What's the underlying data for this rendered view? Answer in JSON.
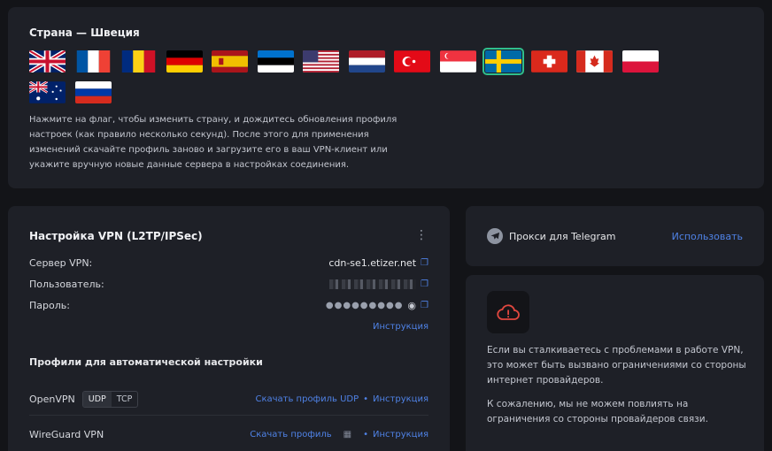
{
  "country": {
    "title": "Страна — Швеция",
    "flags": [
      "United Kingdom",
      "France",
      "Romania",
      "Germany",
      "Spain",
      "Estonia",
      "United States",
      "Netherlands",
      "Turkey",
      "Singapore",
      "Sweden",
      "Switzerland",
      "Canada",
      "Poland",
      "Australia",
      "Russia"
    ],
    "selected": "Sweden",
    "help": "Нажмите на флаг, чтобы изменить страну, и дождитесь обновления профиля настроек (как правило несколько секунд). После этого для применения изменений скачайте профиль заново и загрузите его в ваш VPN-клиент или укажите вручную новые данные сервера в настройках соединения."
  },
  "vpn": {
    "title": "Настройка VPN (L2TP/IPSec)",
    "server_label": "Сервер VPN:",
    "server_value": "cdn-se1.etizer.net",
    "user_label": "Пользователь:",
    "password_label": "Пароль:",
    "password_mask": "●●●●●●●●●",
    "instruction": "Инструкция",
    "profiles_title": "Профили для автоматической настройки",
    "openvpn_label": "OpenVPN",
    "udp": "UDP",
    "tcp": "TCP",
    "download_udp": "Скачать профиль UDP",
    "wireguard_label": "WireGuard VPN",
    "download_profile": "Скачать профиль",
    "bullet": "•"
  },
  "telegram": {
    "label": "Прокси для Telegram",
    "action": "Использовать"
  },
  "warning": {
    "p1": "Если вы сталкиваетесь с проблемами в работе VPN, это может быть вызвано ограничениями со стороны интернет провайдеров.",
    "p2": "К сожалению, мы не можем повлиять на ограничения со стороны провайдеров связи."
  },
  "colors": {
    "accent": "#4f82e6",
    "selected_outline": "#2fbf8e",
    "warning": "#e0473f"
  },
  "icons": {
    "copy": "copy-icon",
    "eye": "eye-icon",
    "menu": "kebab-menu-icon",
    "telegram": "telegram-icon",
    "cloud": "cloud-alert-icon",
    "qr": "qr-code-icon"
  }
}
